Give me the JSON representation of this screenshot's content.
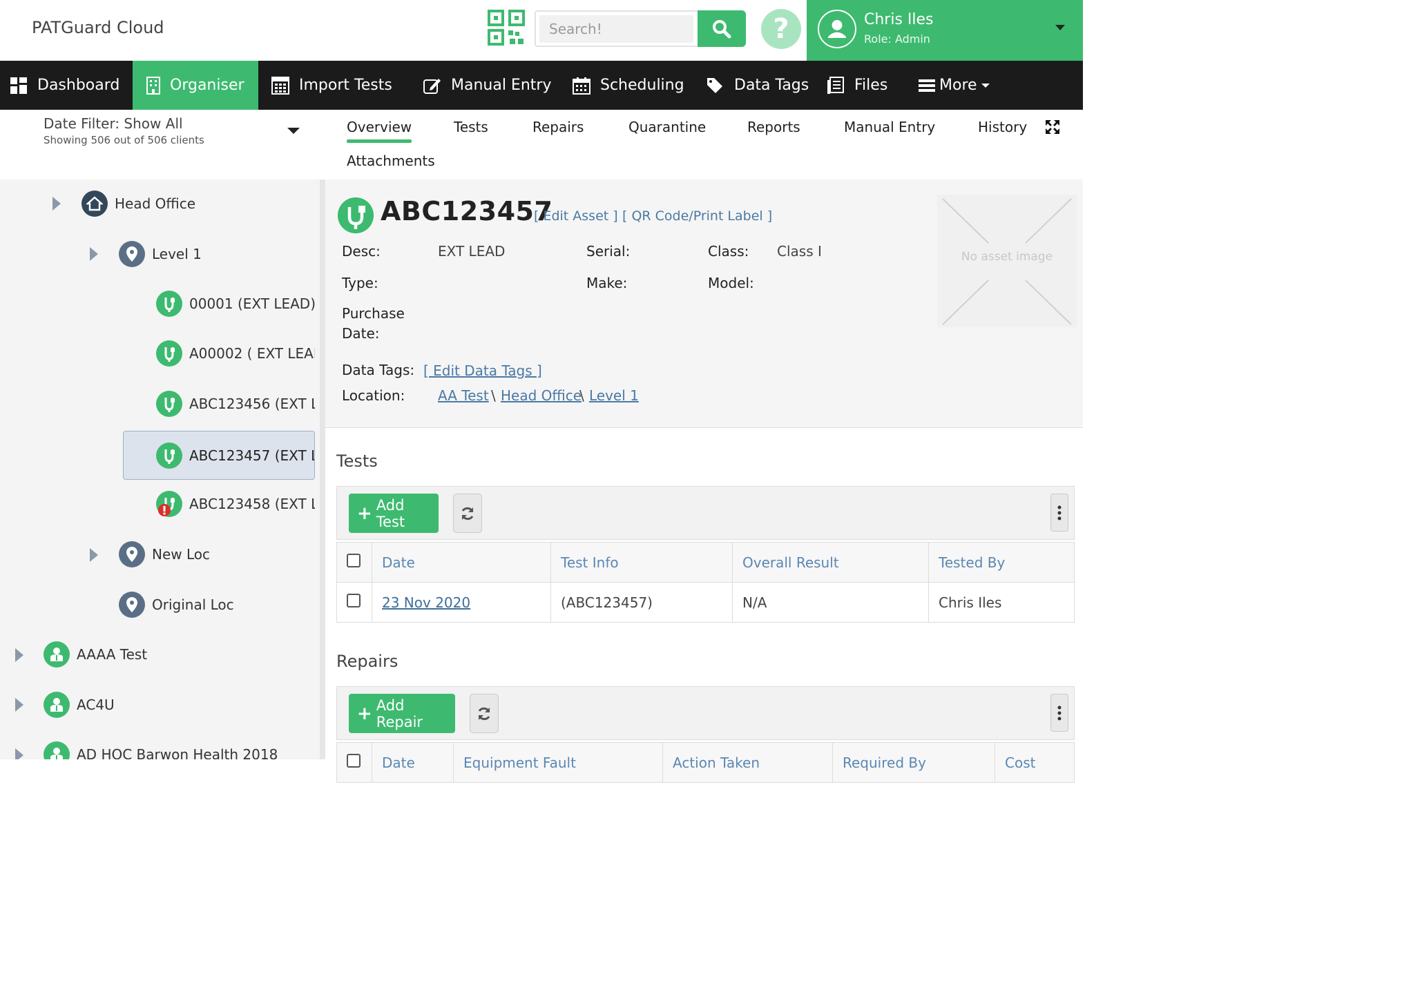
{
  "header": {
    "app_title": "PATGuard Cloud",
    "search_placeholder": "Search!",
    "help_label": "?",
    "user": {
      "name": "Chris Iles",
      "role": "Role: Admin"
    }
  },
  "nav": {
    "items": [
      {
        "label": "Dashboard",
        "icon": "dashboard-icon"
      },
      {
        "label": "Organiser",
        "icon": "building-icon",
        "active": true
      },
      {
        "label": "Import Tests",
        "icon": "calculator-icon"
      },
      {
        "label": "Manual Entry",
        "icon": "edit-icon"
      },
      {
        "label": "Scheduling",
        "icon": "calendar-icon"
      },
      {
        "label": "Data Tags",
        "icon": "tags-icon"
      },
      {
        "label": "Files",
        "icon": "files-icon"
      },
      {
        "label": "More",
        "icon": "list-icon"
      }
    ]
  },
  "date_filter": {
    "title": "Date Filter: Show All",
    "subtitle": "Showing 506 out of 506 clients"
  },
  "tabs": [
    "Overview",
    "Tests",
    "Repairs",
    "Quarantine",
    "Reports",
    "Manual Entry",
    "History",
    "Attachments"
  ],
  "tree": [
    {
      "label": "Head Office"
    },
    {
      "label": "Level 1"
    },
    {
      "label": "00001 (EXT LEAD)"
    },
    {
      "label": "A00002 ( EXT LEAD"
    },
    {
      "label": "ABC123456 (EXT L"
    },
    {
      "label": "ABC123457 (EXT L",
      "selected": true
    },
    {
      "label": "ABC123458 (EXT L",
      "status": "failed"
    },
    {
      "label": "New Loc"
    },
    {
      "label": "Original Loc"
    },
    {
      "label": "AAAA Test"
    },
    {
      "label": "AC4U"
    },
    {
      "label": "AD HOC Barwon Health 2018"
    }
  ],
  "asset": {
    "id": "ABC123457",
    "edit_link": "[ Edit Asset ]",
    "qr_link": "[ QR Code/Print Label ]",
    "labels": {
      "desc": "Desc:",
      "type": "Type:",
      "purchase": "Purchase",
      "purchase2": "Date:",
      "serial": "Serial:",
      "make": "Make:",
      "class": "Class:",
      "model": "Model:",
      "data_tags": "Data Tags:",
      "location": "Location:"
    },
    "desc": "EXT LEAD",
    "class": "Class I",
    "edit_tags_link": "[ Edit Data Tags ]",
    "location": [
      "AA Test",
      "Head Office",
      "Level 1"
    ],
    "location_sep": "\\",
    "no_image": "No asset image"
  },
  "tests_section": {
    "title": "Tests",
    "add_label": "Add Test",
    "columns": [
      "Date",
      "Test Info",
      "Overall Result",
      "Tested By"
    ],
    "rows": [
      {
        "date": "23 Nov 2020",
        "info": "(ABC123457)",
        "result": "N/A",
        "tested_by": "Chris Iles"
      }
    ]
  },
  "repairs_section": {
    "title": "Repairs",
    "add_label": "Add Repair",
    "columns": [
      "Date",
      "Equipment Fault",
      "Action Taken",
      "Required By",
      "Cost"
    ]
  },
  "colors": {
    "accent": "#3dba6f",
    "nav_bg": "#1b1b1b",
    "link": "#4a79a5"
  }
}
